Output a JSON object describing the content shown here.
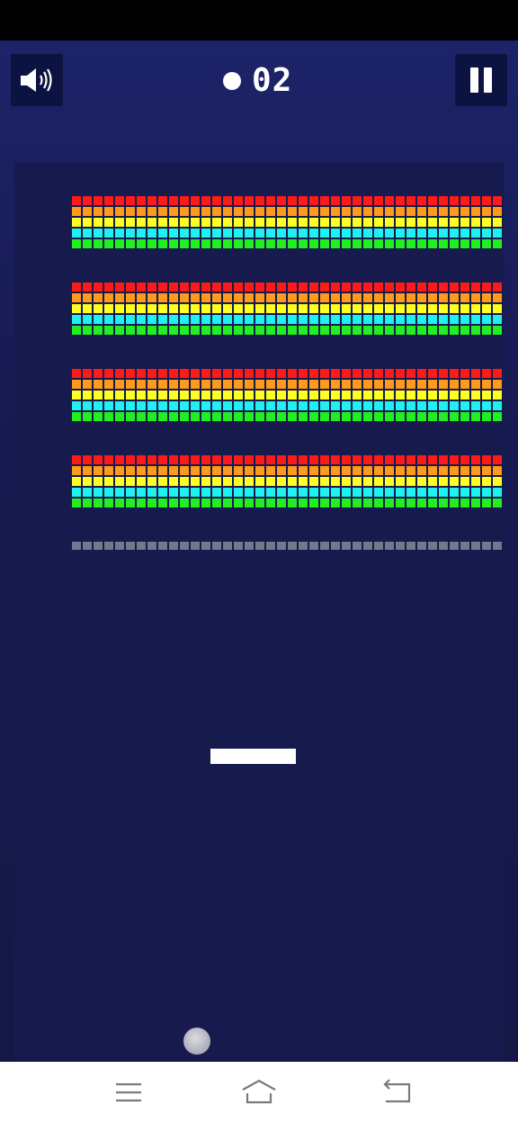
{
  "game": {
    "score": "02",
    "icons": {
      "sound": "speaker-volume-icon",
      "pause": "pause-icon",
      "score_marker": "ball-dot-icon"
    }
  },
  "bricks": {
    "wall_groups": 4,
    "rows_per_group": [
      "#ff1a1a",
      "#ff9a1a",
      "#ffff22",
      "#1ff0f0",
      "#22ee22"
    ],
    "bricks_per_row": 40,
    "bottom_row_color": "#707a8c"
  },
  "colors": {
    "background": "#1b2163",
    "playfield": "#161a4c",
    "paddle": "#ffffff",
    "button_bg": "#0d1340"
  },
  "nav": {
    "icons": [
      "menu-lines-icon",
      "home-icon",
      "back-icon"
    ]
  }
}
